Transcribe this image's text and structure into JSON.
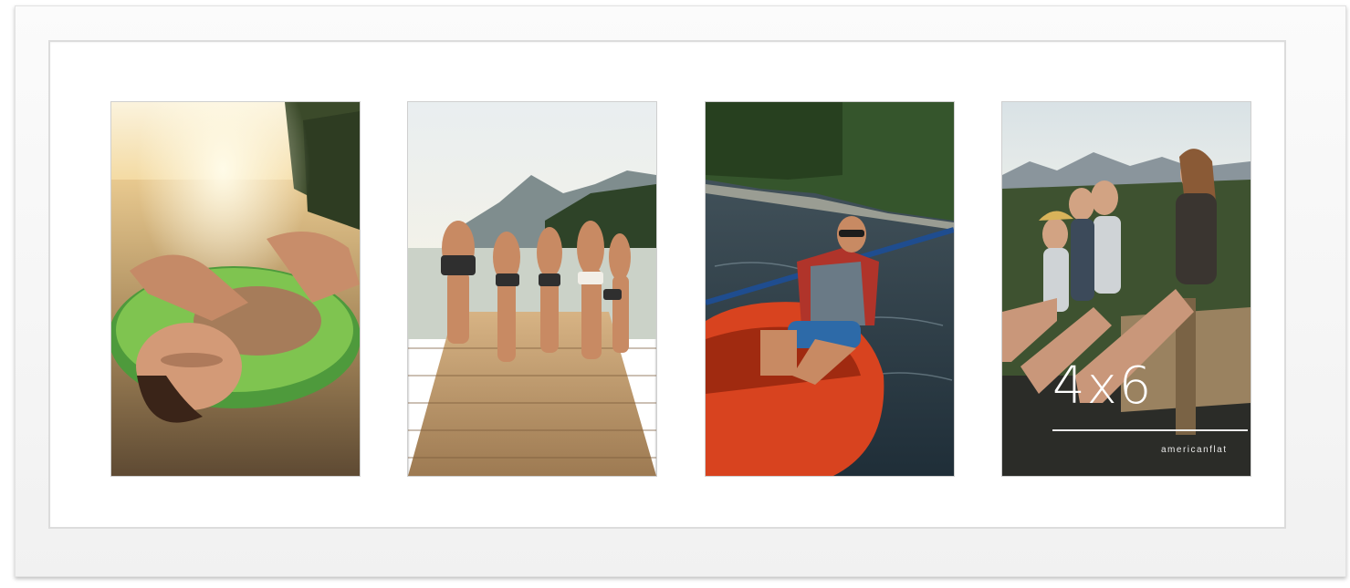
{
  "product": {
    "frame_color": "#f6f6f6",
    "mat_color": "#ffffff",
    "openings": 4
  },
  "photos": [
    {
      "subject": "woman floating on green inner tube in a lake at sunset"
    },
    {
      "subject": "friends in swimwear walking down a wooden dock toward mountains"
    },
    {
      "subject": "man in sunglasses paddling an orange kayak on a river"
    },
    {
      "subject": "friends sitting together on the edge of a wooden pier"
    }
  ],
  "overlay": {
    "size_text": "4x6",
    "brand_text": "americanflat"
  }
}
